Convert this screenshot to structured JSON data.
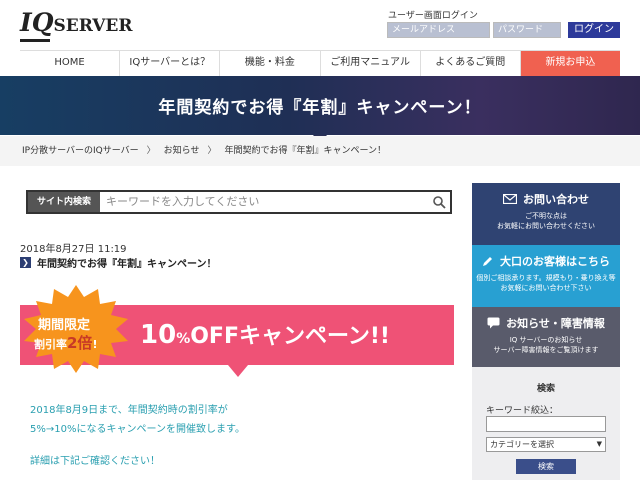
{
  "header": {
    "logo_iq": "IQ",
    "logo_server": "SERVER",
    "login_title": "ユーザー画面ログイン",
    "email_placeholder": "メールアドレス",
    "password_placeholder": "パスワード",
    "login_button": "ログイン"
  },
  "nav": {
    "items": [
      {
        "label": "HOME"
      },
      {
        "label": "IQサーバーとは？"
      },
      {
        "label": "機能・料金"
      },
      {
        "label": "ご利用マニュアル"
      },
      {
        "label": "よくあるご質問"
      },
      {
        "label": "新規お申込"
      }
    ]
  },
  "hero": {
    "title": "年間契約でお得『年割』キャンペーン！"
  },
  "breadcrumb": {
    "items": [
      "IP分散サーバーのIQサーバー",
      "お知らせ",
      "年間契約でお得『年割』キャンペーン！"
    ],
    "separator": "〉"
  },
  "search": {
    "label": "サイト内検索",
    "placeholder": "キーワードを入力してください"
  },
  "post": {
    "date": "2018年8月27日 11:19",
    "title": "年間契約でお得『年割』キャンペーン！"
  },
  "banner": {
    "burst_line1": "期間限定",
    "burst_line2_a": "割引率",
    "burst_line2_b": "2倍",
    "burst_line2_c": "!",
    "num": "10",
    "pct": "%",
    "rest": "OFFキャンペーン!!"
  },
  "body": {
    "line1": "2018年8月9日まで、年間契約時の割引率が",
    "line2": "5%→10%になるキャンペーンを開催致します。",
    "line3": "詳細は下記ご確認ください！"
  },
  "sidebar": {
    "contact": {
      "title": "お問い合わせ",
      "sub1": "ご不明な点は",
      "sub2": "お気軽にお問い合わせください"
    },
    "big_customer": {
      "title": "大口のお客様はこちら",
      "sub1": "個別ご相談承ります。規模もり・乗り換え等",
      "sub2": "お気軽にお問い合わせ下さい"
    },
    "notice": {
      "title": "お知らせ・障害情報",
      "sub1": "IQ サーバーのお知らせ",
      "sub2": "サーバー障害情報をご覧頂けます"
    },
    "search": {
      "title": "検索",
      "keyword_label": "キーワード絞込：",
      "category_selected": "カテゴリーを選択",
      "button": "検索"
    }
  },
  "colors": {
    "nav_apply": "#f06150",
    "contact": "#2f4372",
    "big_customer": "#28a0d2",
    "notice": "#595b6b",
    "banner": "#ef5276",
    "burst": "#f7941d",
    "body_text": "#2a9fb0"
  }
}
